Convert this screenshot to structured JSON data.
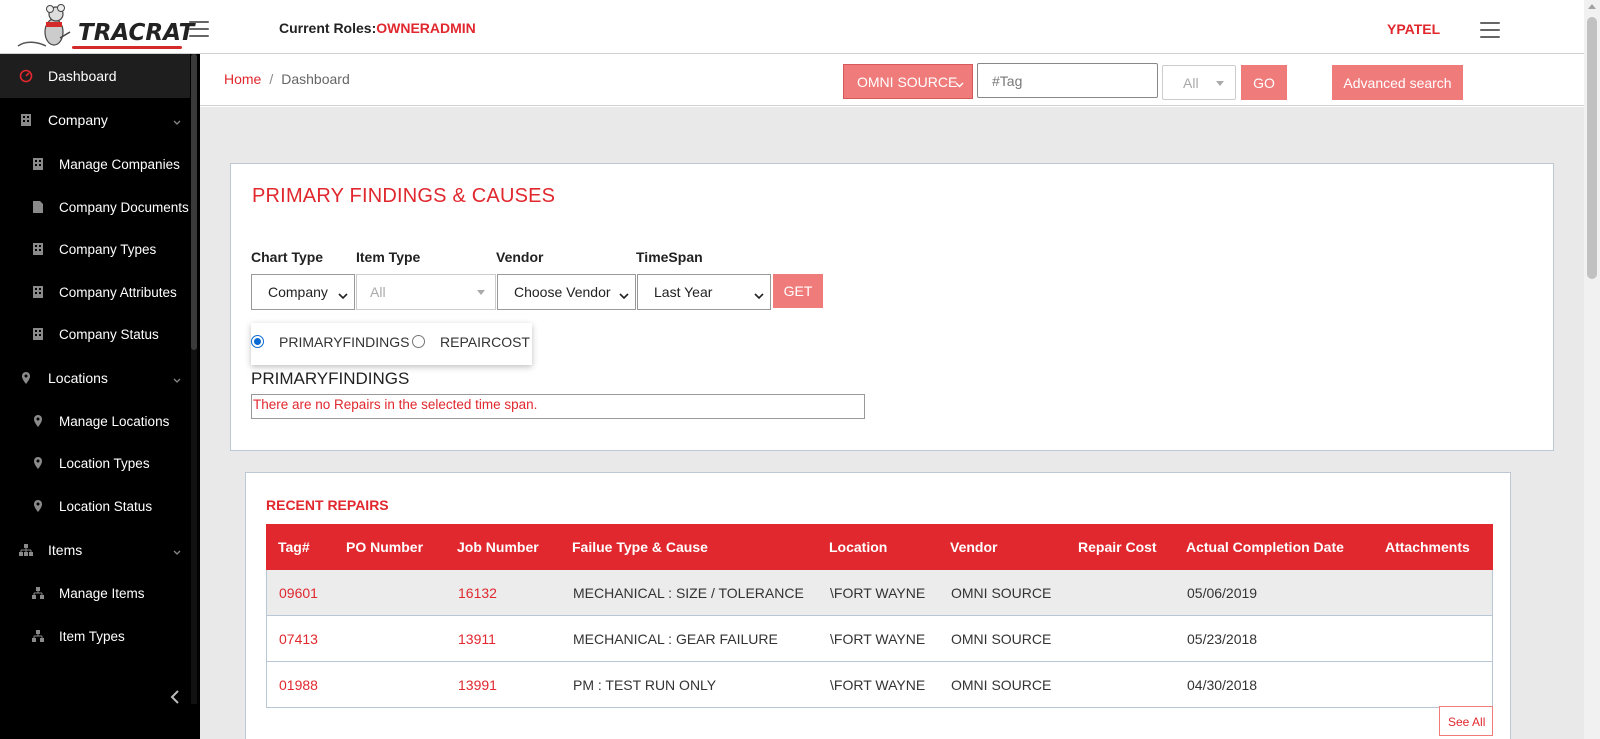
{
  "app": {
    "logo_text": "TRACRAT",
    "current_roles_label": "Current Roles:",
    "current_roles_value": "OWNERADMIN",
    "username": "YPATEL"
  },
  "sidebar": {
    "items": [
      {
        "label": "Dashboard",
        "icon": "gauge-icon",
        "active": true
      },
      {
        "label": "Company",
        "icon": "building-icon",
        "expandable": true
      },
      {
        "label": "Manage Companies",
        "icon": "building-icon"
      },
      {
        "label": "Company Documents",
        "icon": "document-icon"
      },
      {
        "label": "Company Types",
        "icon": "building-icon"
      },
      {
        "label": "Company Attributes",
        "icon": "building-icon"
      },
      {
        "label": "Company Status",
        "icon": "building-icon"
      },
      {
        "label": "Locations",
        "icon": "map-pin-icon",
        "expandable": true
      },
      {
        "label": "Manage Locations",
        "icon": "map-pin-icon"
      },
      {
        "label": "Location Types",
        "icon": "map-pin-icon"
      },
      {
        "label": "Location Status",
        "icon": "map-pin-icon"
      },
      {
        "label": "Items",
        "icon": "sitemap-icon",
        "expandable": true
      },
      {
        "label": "Manage Items",
        "icon": "sitemap-icon"
      },
      {
        "label": "Item Types",
        "icon": "sitemap-icon"
      }
    ]
  },
  "breadcrumb": {
    "home": "Home",
    "separator": "/",
    "current": "Dashboard"
  },
  "search": {
    "source_label": "OMNI SOURCE",
    "tag_placeholder": "#Tag",
    "scope_value": "All",
    "go_label": "GO",
    "advanced_label": "Advanced search"
  },
  "findings": {
    "title": "PRIMARY FINDINGS & CAUSES",
    "filters": {
      "chart_type_label": "Chart Type",
      "chart_type_value": "Company",
      "item_type_label": "Item Type",
      "item_type_value": "All",
      "vendor_label": "Vendor",
      "vendor_value": "Choose Vendor",
      "timespan_label": "TimeSpan",
      "timespan_value": "Last Year",
      "get_label": "GET"
    },
    "radios": {
      "option1": "PRIMARYFINDINGS",
      "option2": "REPAIRCOST",
      "selected": "PRIMARYFINDINGS"
    },
    "section_heading": "PRIMARYFINDINGS",
    "empty_message": "There are no Repairs in the selected time span."
  },
  "recent_repairs": {
    "title": "RECENT REPAIRS",
    "columns": [
      "Tag#",
      "PO Number",
      "Job Number",
      "Failue Type & Cause",
      "Location",
      "Vendor",
      "Repair Cost",
      "Actual Completion Date",
      "Attachments"
    ],
    "rows": [
      {
        "tag": "09601",
        "po": "",
        "job": "16132",
        "failure": "MECHANICAL : SIZE / TOLERANCE",
        "location": "\\FORT WAYNE",
        "vendor": "OMNI SOURCE",
        "cost": "",
        "date": "05/06/2019",
        "attachments": ""
      },
      {
        "tag": "07413",
        "po": "",
        "job": "13911",
        "failure": "MECHANICAL : GEAR FAILURE",
        "location": "\\FORT WAYNE",
        "vendor": "OMNI SOURCE",
        "cost": "",
        "date": "05/23/2018",
        "attachments": ""
      },
      {
        "tag": "01988",
        "po": "",
        "job": "13991",
        "failure": "PM : TEST RUN ONLY",
        "location": "\\FORT WAYNE",
        "vendor": "OMNI SOURCE",
        "cost": "",
        "date": "04/30/2018",
        "attachments": ""
      }
    ],
    "see_all_label": "See All"
  },
  "colors": {
    "brand_red": "#e0282e",
    "button_red": "#f07b7b",
    "sidebar_bg": "#000000"
  }
}
